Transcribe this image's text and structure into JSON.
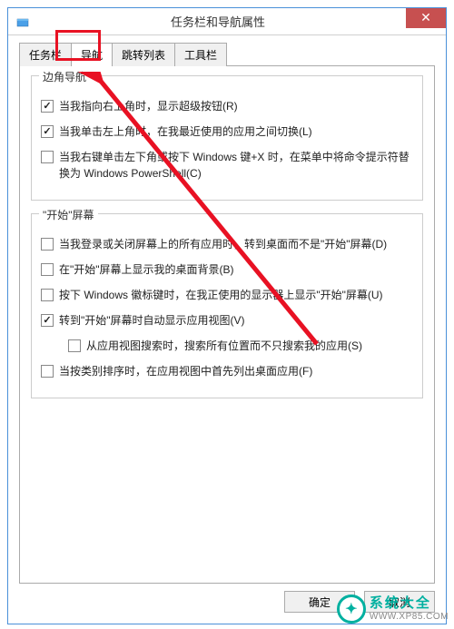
{
  "window": {
    "title": "任务栏和导航属性"
  },
  "tabs": {
    "items": [
      {
        "label": "任务栏"
      },
      {
        "label": "导航"
      },
      {
        "label": "跳转列表"
      },
      {
        "label": "工具栏"
      }
    ],
    "activeIndex": 1
  },
  "groups": {
    "corner": {
      "title": "边角导航",
      "items": [
        {
          "checked": true,
          "label": "当我指向右上角时，显示超级按钮(R)"
        },
        {
          "checked": true,
          "label": "当我单击左上角时，在我最近使用的应用之间切换(L)"
        },
        {
          "checked": false,
          "label": "当我右键单击左下角或按下 Windows 键+X 时，在菜单中将命令提示符替换为 Windows PowerShell(C)"
        }
      ]
    },
    "start": {
      "title": "\"开始\"屏幕",
      "items": [
        {
          "checked": false,
          "indent": false,
          "label": "当我登录或关闭屏幕上的所有应用时，转到桌面而不是\"开始\"屏幕(D)"
        },
        {
          "checked": false,
          "indent": false,
          "label": "在\"开始\"屏幕上显示我的桌面背景(B)"
        },
        {
          "checked": false,
          "indent": false,
          "label": "按下 Windows 徽标键时，在我正使用的显示器上显示\"开始\"屏幕(U)"
        },
        {
          "checked": true,
          "indent": false,
          "label": "转到\"开始\"屏幕时自动显示应用视图(V)"
        },
        {
          "checked": false,
          "indent": true,
          "label": "从应用视图搜索时，搜索所有位置而不只搜索我的应用(S)"
        },
        {
          "checked": false,
          "indent": false,
          "label": "当按类别排序时，在应用视图中首先列出桌面应用(F)"
        }
      ]
    }
  },
  "buttons": {
    "ok": "确定",
    "cancel": "取消"
  },
  "watermark": {
    "title": "系统大全",
    "url": "WWW.XP85.COM"
  }
}
